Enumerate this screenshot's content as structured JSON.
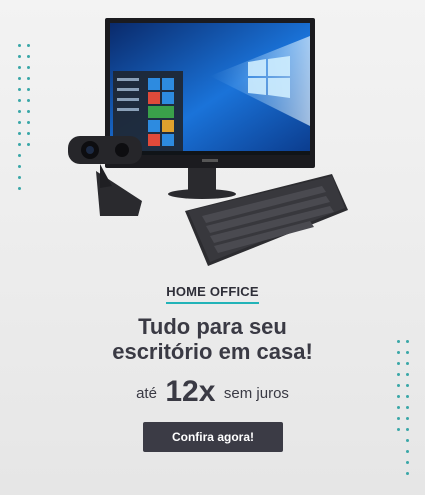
{
  "banner": {
    "category": "HOME OFFICE",
    "headline_line1": "Tudo para seu",
    "headline_line2": "escritório em casa!",
    "installments_prefix": "até",
    "installments_value": "12x",
    "installments_suffix": "sem juros",
    "cta_label": "Confira agora!"
  },
  "colors": {
    "accent": "#22b3b8",
    "text": "#3a3a44",
    "button_bg": "#3b3b45",
    "background": "#ececec"
  },
  "icons": [
    "monitor-icon",
    "webcam-icon",
    "keyboard-icon"
  ]
}
